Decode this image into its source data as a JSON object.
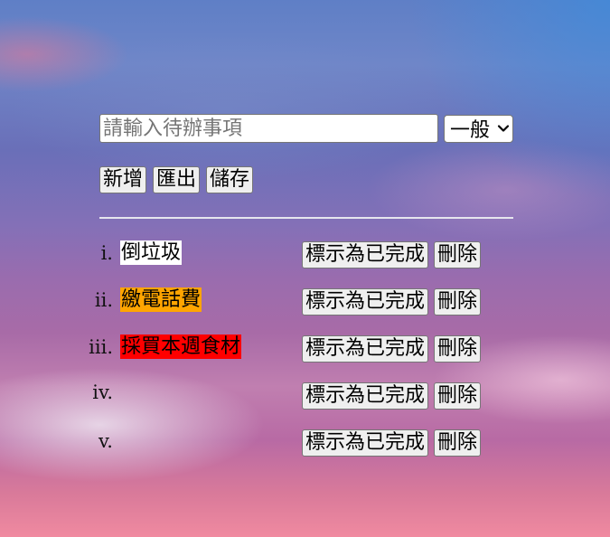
{
  "input": {
    "placeholder": "請輸入待辦事項",
    "value": ""
  },
  "category_select": {
    "selected": "一般"
  },
  "actions": {
    "add_label": "新增",
    "export_label": "匯出",
    "save_label": "儲存"
  },
  "todos": [
    {
      "marker": "i.",
      "text": "倒垃圾",
      "highlight": "#ffffff",
      "complete_label": "標示為已完成",
      "delete_label": "刪除"
    },
    {
      "marker": "ii.",
      "text": "繳電話費",
      "highlight": "#ffa500",
      "complete_label": "標示為已完成",
      "delete_label": "刪除"
    },
    {
      "marker": "iii.",
      "text": "採買本週食材",
      "highlight": "#ff0000",
      "complete_label": "標示為已完成",
      "delete_label": "刪除"
    },
    {
      "marker": "iv.",
      "text": "",
      "highlight": "",
      "complete_label": "標示為已完成",
      "delete_label": "刪除"
    },
    {
      "marker": "v.",
      "text": "",
      "highlight": "",
      "complete_label": "標示為已完成",
      "delete_label": "刪除"
    }
  ]
}
